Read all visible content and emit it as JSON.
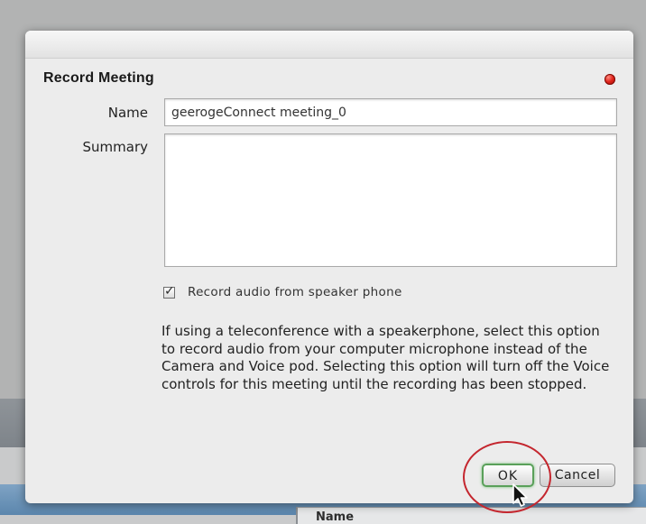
{
  "background": {
    "column_header": "Name"
  },
  "dialog": {
    "title": "Record Meeting",
    "name_label": "Name",
    "name_value": "geerogeConnect meeting_0",
    "summary_label": "Summary",
    "summary_value": "",
    "record_audio_checked": true,
    "record_audio_label": "Record audio from speaker phone",
    "help_text": "If using a teleconference with a speakerphone, select this option to record audio from your computer microphone instead of the Camera and Voice pod. Selecting this option will turn off the Voice controls for this meeting until the recording has been stopped.",
    "ok_label": "OK",
    "cancel_label": "Cancel"
  },
  "colors": {
    "close_button": "#e0241b",
    "ok_border": "#5aa05a",
    "highlight": "#c4262e"
  },
  "icons": {
    "close": "close-icon",
    "checkmark": "checkmark-icon",
    "cursor": "mouse-pointer-icon"
  }
}
